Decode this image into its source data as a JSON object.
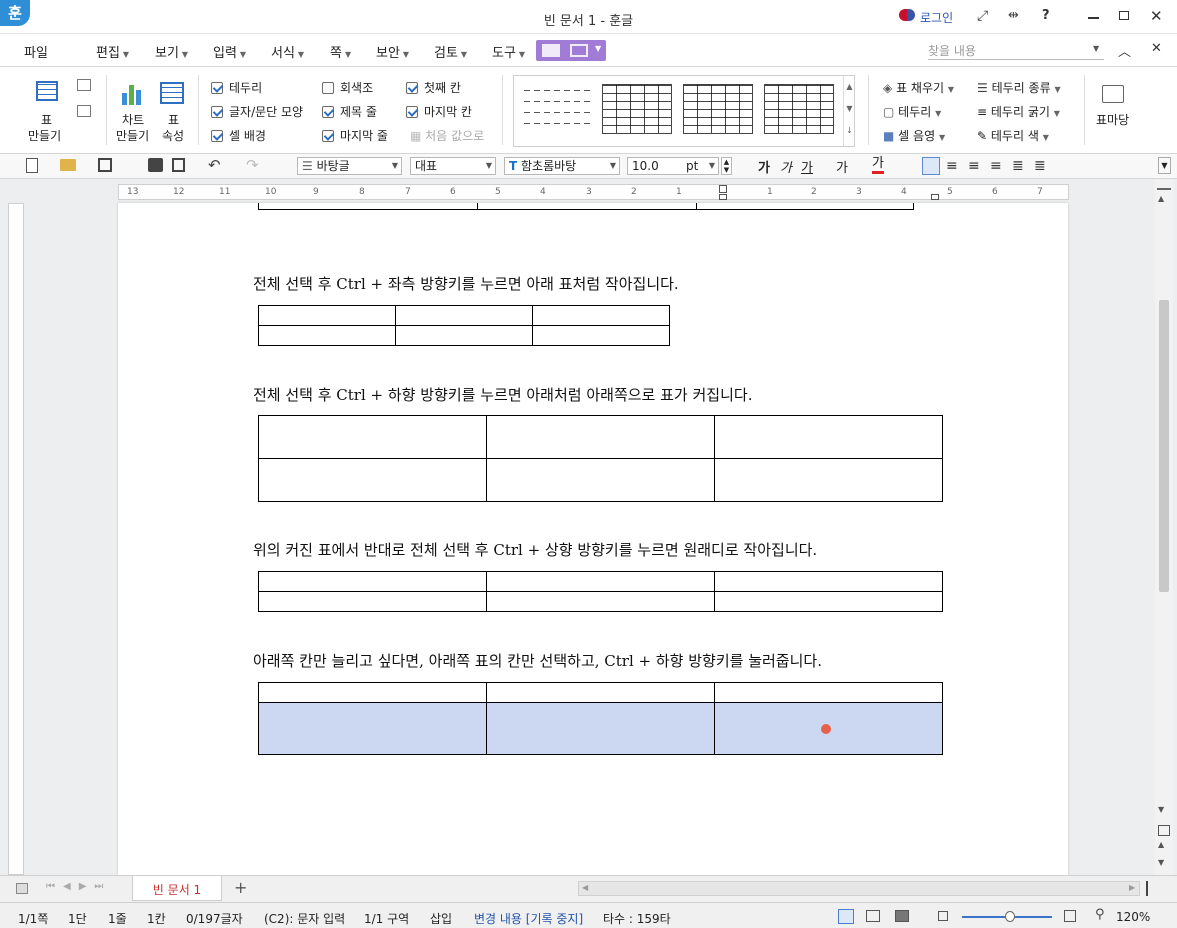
{
  "window": {
    "title": "빈 문서 1 - 훈글",
    "app_logo": "훈",
    "login": "로그인",
    "help": "?"
  },
  "menu": {
    "file": "파일",
    "items": [
      "편집",
      "보기",
      "입력",
      "서식",
      "쪽",
      "보안",
      "검토",
      "도구"
    ],
    "find_placeholder": "찾을 내용"
  },
  "ribbon": {
    "table_create": {
      "line1": "표",
      "line2": "만들기"
    },
    "chart_create": {
      "line1": "차트",
      "line2": "만들기"
    },
    "table_props": {
      "line1": "표",
      "line2": "속성"
    },
    "checks": [
      {
        "label": "테두리",
        "checked": true
      },
      {
        "label": "글자/문단 모양",
        "checked": true
      },
      {
        "label": "셀 배경",
        "checked": true
      },
      {
        "label": "회색조",
        "checked": false
      },
      {
        "label": "제목 줄",
        "checked": true
      },
      {
        "label": "마지막 줄",
        "checked": true
      },
      {
        "label": "첫째 칸",
        "checked": true
      },
      {
        "label": "마지막 칸",
        "checked": true
      }
    ],
    "reset_style": "처음 값으로",
    "fill": "표 채우기",
    "border": "테두리",
    "cell_shade": "셀 음영",
    "border_type": "테두리 종류",
    "border_width": "테두리 굵기",
    "border_color": "테두리 색",
    "bookmark": "표마당"
  },
  "toolbar": {
    "style": "바탕글",
    "lang": "대표",
    "font": "함초롬바탕",
    "size": "10.0",
    "unit": "pt",
    "bold": "가",
    "italic": "가",
    "underline": "가",
    "strike": "가",
    "color": "가"
  },
  "ruler": {
    "left_numbers": [
      "13",
      "12",
      "11",
      "10",
      "9",
      "8",
      "7",
      "6",
      "5",
      "4",
      "3",
      "2",
      "1"
    ],
    "right_numbers": [
      "1",
      "2",
      "3",
      "4",
      "5",
      "6",
      "7"
    ]
  },
  "document": {
    "paragraphs": [
      "전체 선택 후  Ctrl + 좌측 방향키를  누르면 아래 표처럼 작아집니다.",
      "전체 선택 후  Ctrl + 하향 방향키를 누르면 아래처럼 아래쪽으로 표가 커집니다.",
      "위의 커진 표에서 반대로 전체 선택 후  Ctrl + 상향 방향키를 누르면 원래디로 작아집니다.",
      "아래쪽 칸만 늘리고 싶다면, 아래쪽 표의 칸만 선택하고, Ctrl + 하향 방향키를 눌러줍니다."
    ],
    "selection_color": "#ccd7f2",
    "cursor_color": "#e8604a"
  },
  "tabs": {
    "doc_tab": "빈 문서 1",
    "add": "+"
  },
  "status": {
    "page": "1/1쪽",
    "column": "1단",
    "line": "1줄",
    "col": "1칸",
    "chars": "0/197글자",
    "mode": "(C2): 문자 입력",
    "section": "1/1 구역",
    "insert": "삽입",
    "track": "변경 내용 [기록 중지]",
    "typing": "타수 : 159타",
    "zoom": "120%"
  }
}
